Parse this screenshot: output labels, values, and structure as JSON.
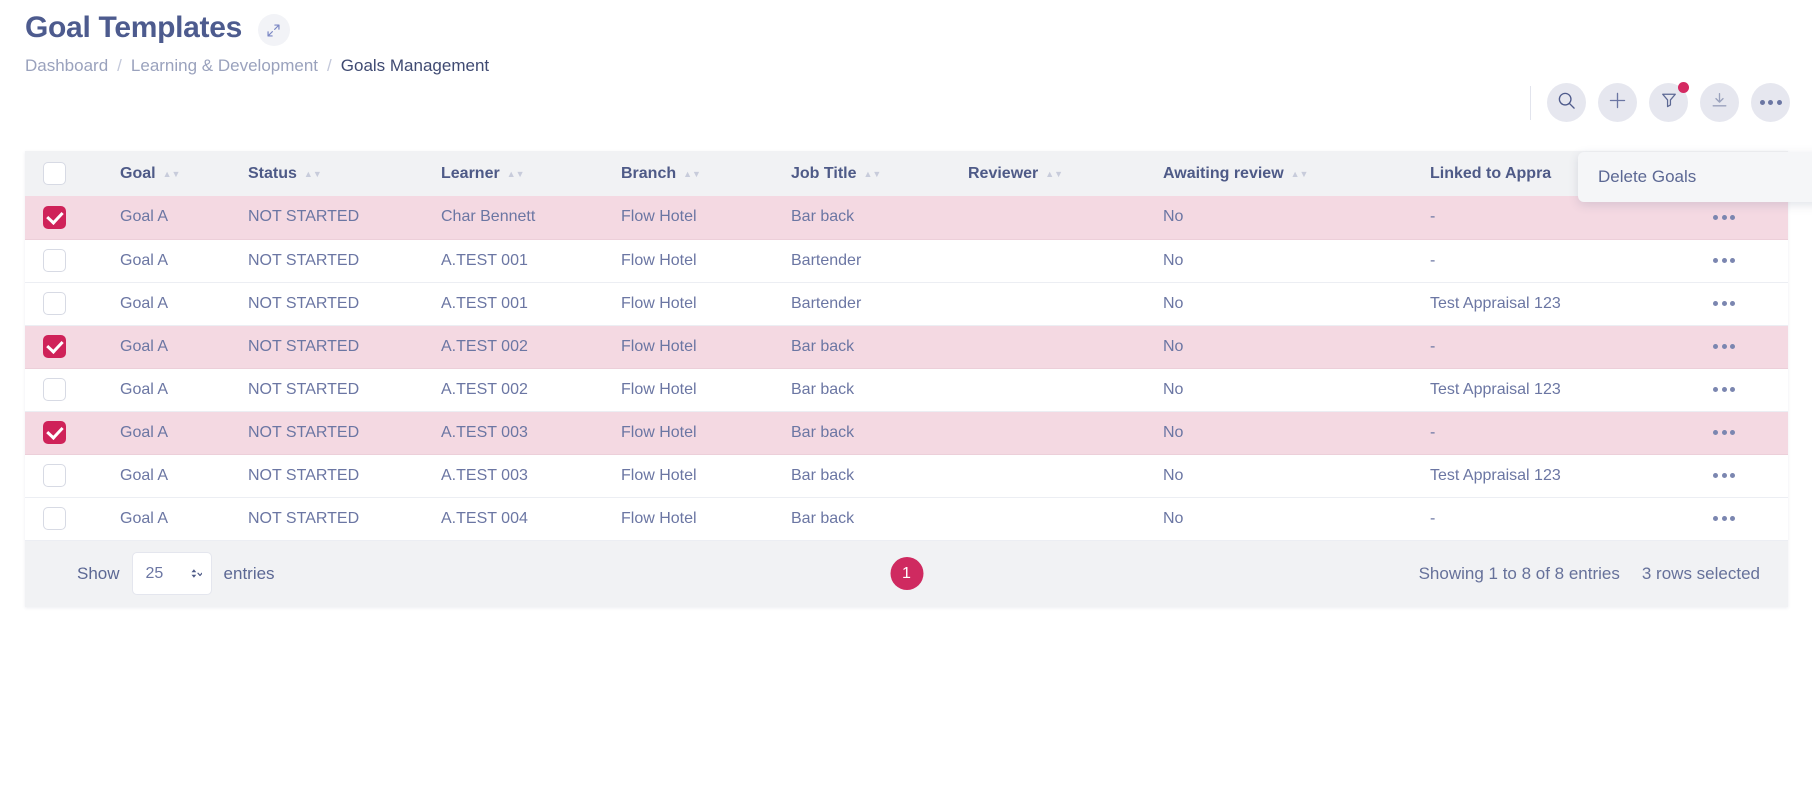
{
  "header": {
    "title": "Goal Templates",
    "expand_icon": "expand-arrows-icon",
    "breadcrumb": [
      {
        "label": "Dashboard",
        "current": false
      },
      {
        "label": "Learning & Development",
        "current": false
      },
      {
        "label": "Goals Management",
        "current": true
      }
    ],
    "separator": "/"
  },
  "toolbar": {
    "buttons": [
      {
        "icon": "search-icon",
        "name": "search-button"
      },
      {
        "icon": "plus-icon",
        "name": "add-button"
      },
      {
        "icon": "filter-icon",
        "name": "filter-button",
        "badge": true
      },
      {
        "icon": "download-icon",
        "name": "download-button"
      },
      {
        "icon": "ellipsis-icon",
        "name": "more-actions-button"
      }
    ],
    "badge_color": "#d42a62"
  },
  "dropdown": {
    "items": [
      {
        "label": "Delete Goals"
      }
    ]
  },
  "table": {
    "select_all_checked": false,
    "columns": [
      {
        "label": "",
        "sortable": false
      },
      {
        "label": "Goal",
        "sortable": true
      },
      {
        "label": "Status",
        "sortable": true
      },
      {
        "label": "Learner",
        "sortable": true
      },
      {
        "label": "Branch",
        "sortable": true
      },
      {
        "label": "Job Title",
        "sortable": true
      },
      {
        "label": "Reviewer",
        "sortable": true
      },
      {
        "label": "Awaiting review",
        "sortable": true
      },
      {
        "label": "Linked to Appra",
        "sortable": false
      },
      {
        "label": "",
        "sortable": false
      }
    ],
    "rows": [
      {
        "selected": true,
        "goal": "Goal A",
        "status": "NOT STARTED",
        "learner": "Char Bennett",
        "branch": "Flow Hotel",
        "job_title": "Bar back",
        "reviewer": "",
        "awaiting_review": "No",
        "linked_to_appraisal": "-"
      },
      {
        "selected": false,
        "goal": "Goal A",
        "status": "NOT STARTED",
        "learner": "A.TEST 001",
        "branch": "Flow Hotel",
        "job_title": "Bartender",
        "reviewer": "",
        "awaiting_review": "No",
        "linked_to_appraisal": "-"
      },
      {
        "selected": false,
        "goal": "Goal A",
        "status": "NOT STARTED",
        "learner": "A.TEST 001",
        "branch": "Flow Hotel",
        "job_title": "Bartender",
        "reviewer": "",
        "awaiting_review": "No",
        "linked_to_appraisal": "Test Appraisal 123"
      },
      {
        "selected": true,
        "goal": "Goal A",
        "status": "NOT STARTED",
        "learner": "A.TEST 002",
        "branch": "Flow Hotel",
        "job_title": "Bar back",
        "reviewer": "",
        "awaiting_review": "No",
        "linked_to_appraisal": "-"
      },
      {
        "selected": false,
        "goal": "Goal A",
        "status": "NOT STARTED",
        "learner": "A.TEST 002",
        "branch": "Flow Hotel",
        "job_title": "Bar back",
        "reviewer": "",
        "awaiting_review": "No",
        "linked_to_appraisal": "Test Appraisal 123"
      },
      {
        "selected": true,
        "goal": "Goal A",
        "status": "NOT STARTED",
        "learner": "A.TEST 003",
        "branch": "Flow Hotel",
        "job_title": "Bar back",
        "reviewer": "",
        "awaiting_review": "No",
        "linked_to_appraisal": "-"
      },
      {
        "selected": false,
        "goal": "Goal A",
        "status": "NOT STARTED",
        "learner": "A.TEST 003",
        "branch": "Flow Hotel",
        "job_title": "Bar back",
        "reviewer": "",
        "awaiting_review": "No",
        "linked_to_appraisal": "Test Appraisal 123"
      },
      {
        "selected": false,
        "goal": "Goal A",
        "status": "NOT STARTED",
        "learner": "A.TEST 004",
        "branch": "Flow Hotel",
        "job_title": "Bar back",
        "reviewer": "",
        "awaiting_review": "No",
        "linked_to_appraisal": "-"
      }
    ]
  },
  "footer": {
    "show_label": "Show",
    "entries_label": "entries",
    "page_size": "25",
    "current_page": "1",
    "showing_text": "Showing 1 to 8 of 8 entries",
    "selected_text": "3 rows selected"
  },
  "colors": {
    "accent": "#cf2259",
    "selected_row": "#f4d9e2",
    "header_bg": "#f1f2f4",
    "text": "#6b76a3"
  }
}
